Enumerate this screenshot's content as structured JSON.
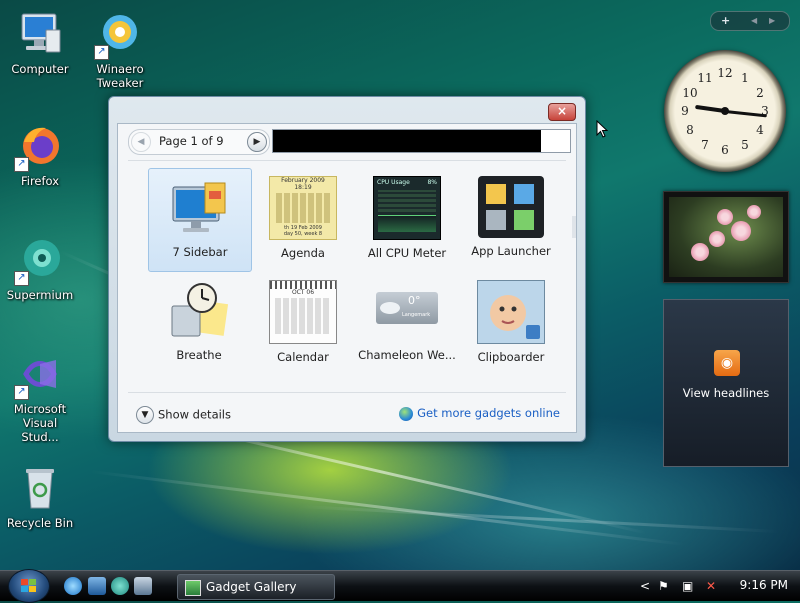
{
  "desktop": {
    "icons": [
      {
        "label": "Computer"
      },
      {
        "label": "Winaero Tweaker"
      },
      {
        "label": "Firefox"
      },
      {
        "label": "Supermium"
      },
      {
        "label": "Microsoft Visual Stud..."
      },
      {
        "label": "Recycle Bin"
      }
    ]
  },
  "gallery": {
    "close_label": "×",
    "page_text": "Page 1 of 9",
    "search_value": "",
    "gadgets": [
      {
        "name": "7 Sidebar",
        "selected": true
      },
      {
        "name": "Agenda"
      },
      {
        "name": "All CPU Meter"
      },
      {
        "name": "App Launcher"
      },
      {
        "name": "Breathe"
      },
      {
        "name": "Calendar"
      },
      {
        "name": "Chameleon We..."
      },
      {
        "name": "Clipboarder"
      }
    ],
    "show_details": "Show details",
    "get_more": "Get more gadgets online"
  },
  "thumbs": {
    "agenda_header": "February 2009",
    "agenda_time": "18:19",
    "agenda_footer1": "th 19 Feb 2009",
    "agenda_footer2": "day 50, week 8",
    "cpu_title": "CPU Usage",
    "cpu_pct": "8%",
    "cal_month": "OCT 06",
    "weather_temp": "0°",
    "weather_place": "Langemark"
  },
  "sidebar": {
    "controls": {
      "add": "+",
      "prev": "◀",
      "next": "▶"
    },
    "clock_numbers": [
      "12",
      "1",
      "2",
      "3",
      "4",
      "5",
      "6",
      "7",
      "8",
      "9",
      "10",
      "11"
    ],
    "feed_text": "View headlines"
  },
  "taskbar": {
    "task_title": "Gadget Gallery",
    "tray_chevron": "<",
    "time": "9:16 PM"
  }
}
